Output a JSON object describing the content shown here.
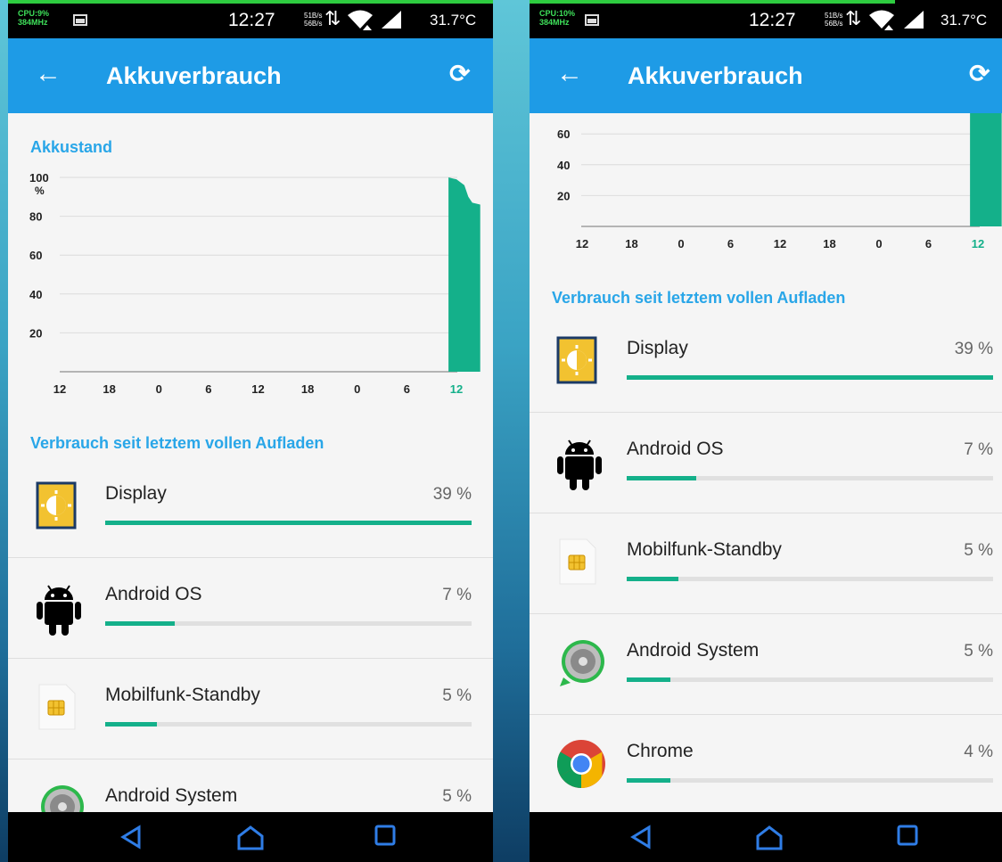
{
  "status_bar": {
    "left": {
      "cpu": "CPU:9%",
      "freq": "384MHz",
      "time": "12:27",
      "net_up": "51B/s",
      "net_down": "56B/s",
      "temp": "31.7°C"
    },
    "right": {
      "cpu": "CPU:10%",
      "freq": "384MHz",
      "time": "12:27",
      "net_up": "51B/s",
      "net_down": "56B/s",
      "temp": "31.7°C"
    }
  },
  "app_bar": {
    "title": "Akkuverbrauch",
    "back_icon": "arrow-back-icon",
    "refresh_icon": "refresh-icon"
  },
  "battery_section": {
    "title": "Akkustand"
  },
  "usage_section": {
    "title": "Verbrauch seit letztem vollen Aufladen"
  },
  "chart_data": {
    "type": "area",
    "title": "Akkustand",
    "y_ticks": [
      "20",
      "40",
      "60",
      "80",
      "100"
    ],
    "y_unit": "%",
    "x_ticks": [
      "12",
      "18",
      "0",
      "6",
      "12",
      "18",
      "0",
      "6",
      "12"
    ],
    "highlighted_x_tick": "12",
    "ylim": [
      0,
      100
    ],
    "x": [
      0.98,
      1.0,
      1.02,
      1.03,
      1.04,
      1.06
    ],
    "y": [
      100,
      99,
      96,
      90,
      87,
      86
    ],
    "color": "#14b08a"
  },
  "usage_items": [
    {
      "name": "Display",
      "percent_label": "39 %",
      "fraction": 1.0,
      "icon": "display-brightness-icon"
    },
    {
      "name": "Android OS",
      "percent_label": "7 %",
      "fraction": 0.19,
      "icon": "android-robot-icon"
    },
    {
      "name": "Mobilfunk-Standby",
      "percent_label": "5 %",
      "fraction": 0.14,
      "icon": "sim-card-icon"
    },
    {
      "name": "Android System",
      "percent_label": "5 %",
      "fraction": 0.12,
      "icon": "android-system-icon"
    },
    {
      "name": "Chrome",
      "percent_label": "4 %",
      "fraction": 0.12,
      "icon": "chrome-icon"
    }
  ],
  "nav_bar": {
    "back": "nav-back-icon",
    "home": "nav-home-icon",
    "recents": "nav-recents-icon"
  },
  "colors": {
    "app_bar": "#1e9be6",
    "accent_text": "#29a6e8",
    "bar_fill": "#14b08a",
    "status_bar": "#000000"
  }
}
